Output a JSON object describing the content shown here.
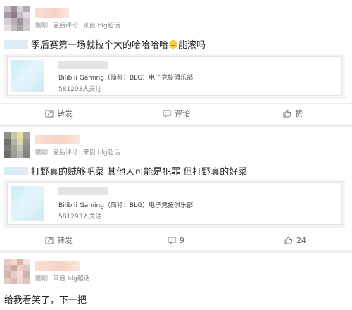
{
  "posts": [
    {
      "time": "刚刚",
      "kind": "最后评论",
      "source": "来自 blg超话",
      "content_before": "季后赛第一场就拉个大的哈哈哈哈",
      "content_after": "能滚吗",
      "emoji": "smiling-face-icon",
      "repost_title": "Bilibili Gaming（简称：BLG）电子竞技俱乐部",
      "repost_followers": "581293人关注",
      "actions": {
        "repost": "转发",
        "comment": "评论",
        "like": "赞"
      }
    },
    {
      "time": "刚刚",
      "kind": "最后评论",
      "source": "来自 blg超话",
      "content": "打野真的贼够吧菜 其他人可能是犯罪 但打野真的好菜",
      "repost_title": "Bilibili Gaming（简称：BLG）电子竞技俱乐部",
      "repost_followers": "581293人关注",
      "actions": {
        "repost": "转发",
        "comment": "9",
        "like": "24"
      }
    },
    {
      "time": "刚刚",
      "source": "来自 blg超话",
      "content": "给我看笑了，下一把"
    }
  ],
  "colors": {
    "background": "#eceef1",
    "card": "#ffffff",
    "meta_text": "#8a8a8a"
  }
}
